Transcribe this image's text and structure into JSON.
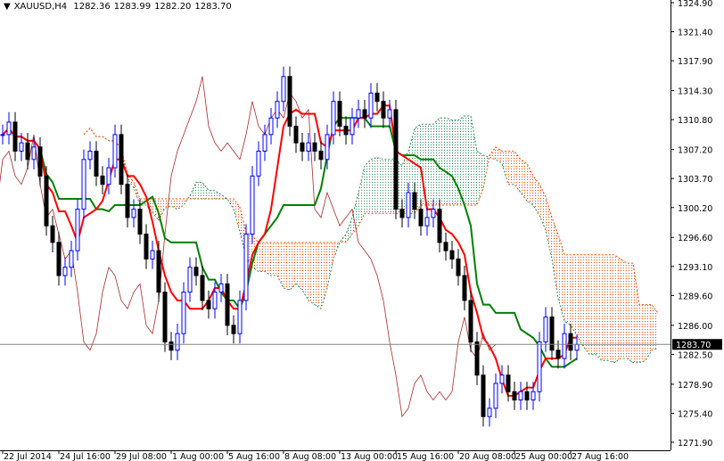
{
  "header": {
    "symbol": "XAUUSD,H4",
    "open": "1282.36",
    "high": "1283.99",
    "low": "1282.20",
    "close": "1283.70"
  },
  "colors": {
    "bull": "#0000ff",
    "bear": "#000000",
    "tenkan": "#ff0000",
    "kijun": "#008000",
    "chikou": "#a52a2a",
    "cloud_bear": "#ff4500",
    "cloud_bull": "#2e8b57",
    "price_line": "#808080"
  },
  "chart_data": {
    "type": "candlestick",
    "title": "XAUUSD,H4",
    "current_price": 1283.7,
    "current_price_label": "1283.70",
    "ylim": [
      1271.9,
      1324.9
    ],
    "y_ticks": [
      "1324.90",
      "1321.40",
      "1317.90",
      "1314.30",
      "1310.80",
      "1307.20",
      "1303.70",
      "1300.20",
      "1296.60",
      "1293.10",
      "1289.60",
      "1286.00",
      "1282.50",
      "1278.90",
      "1275.40",
      "1271.90"
    ],
    "x_ticks": [
      "22 Jul 2014",
      "24 Jul 16:00",
      "29 Jul 08:00",
      "1 Aug 00:00",
      "5 Aug 16:00",
      "8 Aug 08:00",
      "13 Aug 00:00",
      "15 Aug 16:00",
      "20 Aug 08:00",
      "25 Aug 00:00",
      "27 Aug 16:00"
    ],
    "x_tick_bar_index": [
      0,
      9,
      18,
      27,
      36,
      45,
      54,
      63,
      73,
      82,
      91
    ],
    "closes": [
      1309,
      1310.5,
      1307,
      1308,
      1306,
      1307.5,
      1304,
      1298,
      1296,
      1292,
      1293,
      1295,
      1300,
      1306,
      1307,
      1304,
      1303,
      1305,
      1309,
      1303,
      1299,
      1300,
      1297,
      1294,
      1295,
      1290,
      1284,
      1283,
      1285,
      1290,
      1293,
      1292,
      1289,
      1288,
      1290,
      1291,
      1286,
      1285,
      1289,
      1297,
      1304,
      1307,
      1309,
      1311,
      1313,
      1316,
      1310,
      1308,
      1307,
      1308,
      1307,
      1306,
      1309,
      1313,
      1310,
      1309,
      1311,
      1312,
      1311,
      1314,
      1313,
      1311,
      1312,
      1300,
      1299,
      1302,
      1300,
      1298,
      1299,
      1300,
      1296,
      1295,
      1294,
      1292,
      1289,
      1284,
      1280,
      1275,
      1276,
      1279,
      1280,
      1278,
      1277,
      1278,
      1277,
      1278,
      1284,
      1287,
      1283,
      1282,
      1285,
      1283,
      1283.7
    ],
    "indicators": [
      "Ichimoku Tenkan-sen",
      "Ichimoku Kijun-sen",
      "Ichimoku Chikou Span",
      "Ichimoku Cloud"
    ]
  }
}
